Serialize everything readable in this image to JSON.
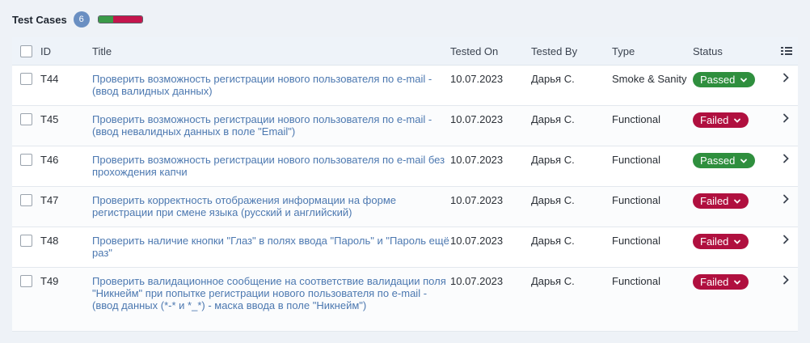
{
  "header": {
    "title": "Test Cases",
    "count": "6"
  },
  "progress": {
    "passed_fraction": 0.33,
    "failed_fraction": 0.67,
    "pass_color": "#3a9a48",
    "fail_color": "#c4154d"
  },
  "columns": {
    "id": "ID",
    "title": "Title",
    "tested_on": "Tested On",
    "tested_by": "Tested By",
    "type": "Type",
    "status": "Status"
  },
  "rows": [
    {
      "id": "T44",
      "title": "Проверить возможность регистрации нового пользователя по e-mail - (ввод валидных данных)",
      "tested_on": "10.07.2023",
      "tested_by": "Дарья С.",
      "type": "Smoke & Sanity",
      "status": "Passed"
    },
    {
      "id": "T45",
      "title": "Проверить возможность регистрации нового пользователя по e-mail - (ввод невалидных данных в поле \"Email\")",
      "tested_on": "10.07.2023",
      "tested_by": "Дарья С.",
      "type": "Functional",
      "status": "Failed"
    },
    {
      "id": "T46",
      "title": "Проверить возможность регистрации нового пользователя по e-mail без прохождения капчи",
      "tested_on": "10.07.2023",
      "tested_by": "Дарья С.",
      "type": "Functional",
      "status": "Passed"
    },
    {
      "id": "T47",
      "title": "Проверить корректность отображения информации на форме регистрации при смене языка (русский и английский)",
      "tested_on": "10.07.2023",
      "tested_by": "Дарья С.",
      "type": "Functional",
      "status": "Failed"
    },
    {
      "id": "T48",
      "title": "Проверить наличие кнопки \"Глаз\" в полях ввода \"Пароль\" и \"Пароль ещё раз\"",
      "tested_on": "10.07.2023",
      "tested_by": "Дарья С.",
      "type": "Functional",
      "status": "Failed"
    },
    {
      "id": "T49",
      "title": "Проверить валидационное сообщение на соответствие валидации поля \"Никнейм\" при попытке регистрации нового пользователя по e-mail - (ввод данных (*-* и *_*) - маска ввода в поле \"Никнейм\")",
      "tested_on": "10.07.2023",
      "tested_by": "Дарья С.",
      "type": "Functional",
      "status": "Failed"
    }
  ]
}
